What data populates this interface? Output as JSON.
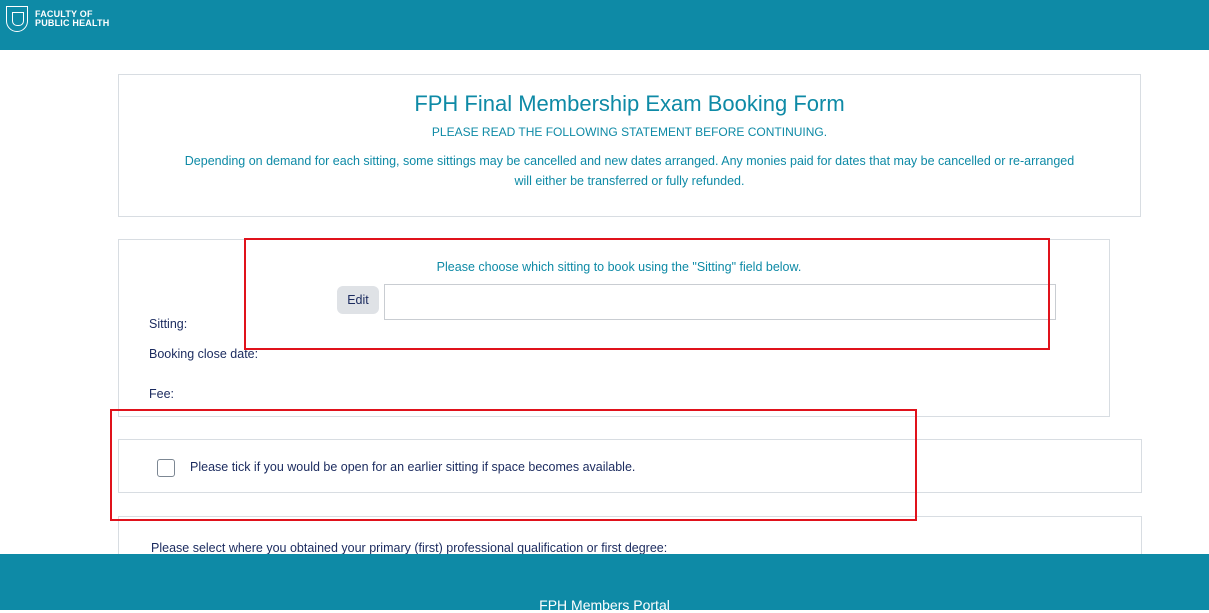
{
  "header": {
    "logo_line1": "FACULTY OF",
    "logo_line2": "PUBLIC HEALTH",
    "logo_icon": "crest-shield-icon"
  },
  "intro": {
    "title": "FPH Final Membership Exam Booking Form",
    "subtitle": "PLEASE READ THE FOLLOWING STATEMENT BEFORE CONTINUING.",
    "notice": "Depending on demand for each sitting, some sittings may be cancelled and new dates arranged. Any monies paid for dates that may be cancelled or re-arranged will either be transferred or fully refunded."
  },
  "sitting_section": {
    "instruction": "Please choose which sitting to book using the \"Sitting\" field below.",
    "sitting_label": "Sitting:",
    "edit_button": "Edit",
    "sitting_value": "",
    "booking_close_label": "Booking close date:",
    "fee_label": "Fee:"
  },
  "earlier_sitting": {
    "checked": false,
    "label": "Please tick if you would be open for an earlier sitting if space becomes available."
  },
  "qualification": {
    "label": "Please select where you obtained your primary (first) professional qualification or first degree:"
  },
  "footer": {
    "text": "FPH Members Portal"
  },
  "colors": {
    "brand": "#0e8aa6",
    "text_dark": "#1a2a5e",
    "highlight": "#e0121b"
  }
}
